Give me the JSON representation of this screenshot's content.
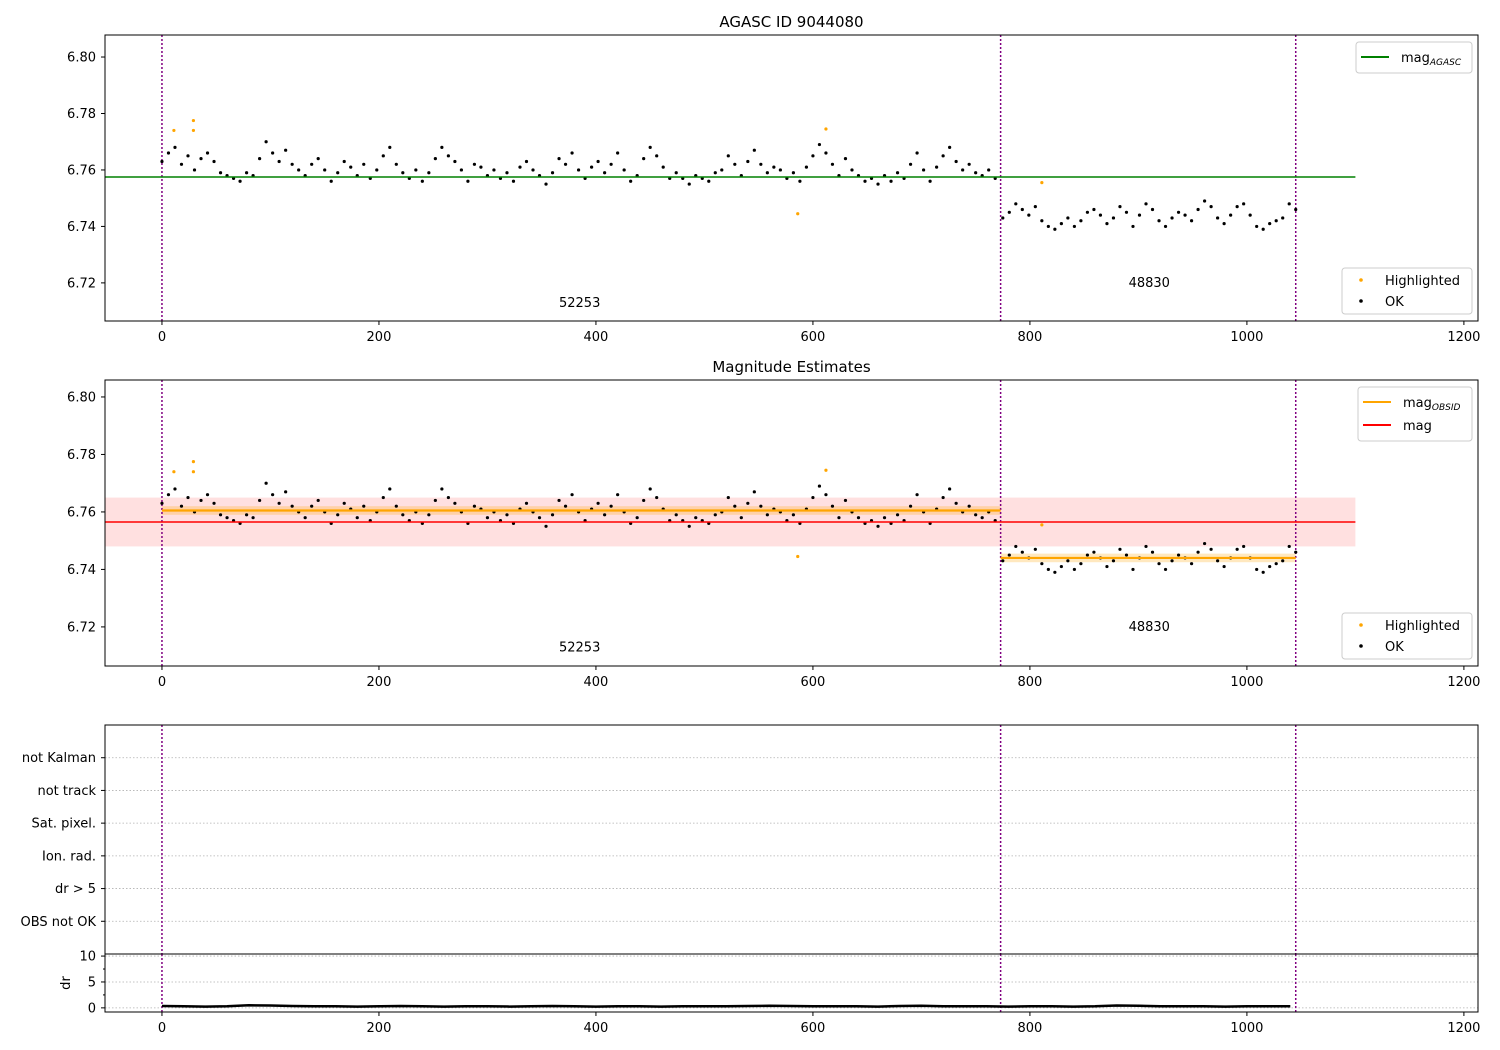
{
  "chart_data": [
    {
      "type": "scatter",
      "title": "AGASC ID 9044080",
      "xlim": [
        -52.5,
        1213
      ],
      "ylim": [
        6.7065,
        6.8078
      ],
      "xticks": [
        "0",
        "200",
        "400",
        "600",
        "800",
        "1000",
        "1200"
      ],
      "xtick_values": [
        0,
        200,
        400,
        600,
        800,
        1000,
        1200
      ],
      "yticks": [
        "6.72",
        "6.74",
        "6.76",
        "6.78",
        "6.80"
      ],
      "ytick_values": [
        6.72,
        6.74,
        6.76,
        6.78,
        6.8
      ],
      "vlines": {
        "x": [
          0,
          773,
          1045
        ],
        "color": "#800080",
        "style": "dotted"
      },
      "segments": [
        {
          "label": "52253",
          "label_x": 385,
          "label_y": 6.7115
        },
        {
          "label": "48830",
          "label_x": 910,
          "label_y": 6.7185
        }
      ],
      "hlines": [
        {
          "name": "mag",
          "sub": "AGASC",
          "y": 6.7575,
          "x": [
            -52.5,
            1100
          ],
          "color": "#008000"
        }
      ],
      "legend_top": {
        "placement": "top-right",
        "entries": [
          {
            "name": "mag",
            "sub": "AGASC",
            "color": "#008000"
          }
        ]
      },
      "legend_bottom": {
        "placement": "bottom-right",
        "entries": [
          {
            "name": "Highlighted",
            "color": "#ffa500"
          },
          {
            "name": "OK",
            "color": "#000000"
          }
        ]
      }
    },
    {
      "type": "scatter",
      "title": "Magnitude Estimates",
      "xlim": [
        -52.5,
        1213
      ],
      "ylim": [
        6.7064,
        6.8059
      ],
      "xticks": [
        "0",
        "200",
        "400",
        "600",
        "800",
        "1000",
        "1200"
      ],
      "xtick_values": [
        0,
        200,
        400,
        600,
        800,
        1000,
        1200
      ],
      "yticks": [
        "6.72",
        "6.74",
        "6.76",
        "6.78",
        "6.80"
      ],
      "ytick_values": [
        6.72,
        6.74,
        6.76,
        6.78,
        6.8
      ],
      "vlines": {
        "x": [
          0,
          773,
          1045
        ],
        "color": "#800080",
        "style": "dotted"
      },
      "segments": [
        {
          "label": "52253",
          "label_x": 385,
          "label_y": 6.7115
        },
        {
          "label": "48830",
          "label_x": 910,
          "label_y": 6.7185
        }
      ],
      "bands": [
        {
          "x": [
            -52.5,
            1100
          ],
          "y": [
            6.748,
            6.765
          ],
          "color": "#ff0000",
          "opacity": 0.12
        },
        {
          "x": [
            0,
            773
          ],
          "y": [
            6.759,
            6.762
          ],
          "color": "#ffa500",
          "opacity": 0.25
        },
        {
          "x": [
            773,
            1045
          ],
          "y": [
            6.7425,
            6.7455
          ],
          "color": "#ffa500",
          "opacity": 0.25
        }
      ],
      "hlines": [
        {
          "name": "mag",
          "y": 6.7565,
          "x": [
            -52.5,
            1100
          ],
          "color": "#ff0000"
        },
        {
          "name": "mag",
          "sub": "OBSID",
          "y": 6.7605,
          "x": [
            0,
            773
          ],
          "color": "#ffa500"
        },
        {
          "name": "mag",
          "sub": "OBSID",
          "y": 6.744,
          "x": [
            773,
            1045
          ],
          "color": "#ffa500"
        }
      ],
      "legend_top": {
        "placement": "top-right",
        "entries": [
          {
            "name": "mag",
            "sub": "OBSID",
            "color": "#ffa500"
          },
          {
            "name": "mag",
            "sub": "",
            "color": "#ff0000"
          }
        ]
      },
      "legend_bottom": {
        "placement": "bottom-right",
        "entries": [
          {
            "name": "Highlighted",
            "color": "#ffa500"
          },
          {
            "name": "OK",
            "color": "#000000"
          }
        ]
      }
    },
    {
      "type": "scatter",
      "xlim": [
        -52.5,
        1213
      ],
      "ylim": [
        -1,
        6
      ],
      "categories": [
        "OBS not OK",
        "dr > 5",
        "Ion. rad.",
        "Sat. pixel.",
        "not track",
        "not Kalman"
      ],
      "grid": true,
      "points": [],
      "vlines": {
        "x": [
          0,
          773,
          1045
        ],
        "color": "#800080",
        "style": "dotted"
      }
    },
    {
      "type": "line",
      "ylabel": "dr",
      "xlim": [
        -52.5,
        1213
      ],
      "ylim": [
        -0.8,
        10.4
      ],
      "xticks": [
        "0",
        "200",
        "400",
        "600",
        "800",
        "1000",
        "1200"
      ],
      "xtick_values": [
        0,
        200,
        400,
        600,
        800,
        1000,
        1200
      ],
      "yticks": [
        "0",
        "5",
        "10"
      ],
      "ytick_values": [
        0,
        5,
        10
      ],
      "grid": true,
      "vlines": {
        "x": [
          0,
          773,
          1045
        ],
        "color": "#800080",
        "style": "dotted"
      },
      "x_start": 0,
      "x_step": 20,
      "values": [
        0.35,
        0.3,
        0.25,
        0.3,
        0.5,
        0.45,
        0.35,
        0.3,
        0.3,
        0.25,
        0.3,
        0.35,
        0.3,
        0.25,
        0.3,
        0.3,
        0.25,
        0.3,
        0.35,
        0.3,
        0.25,
        0.3,
        0.3,
        0.25,
        0.3,
        0.3,
        0.3,
        0.35,
        0.4,
        0.35,
        0.3,
        0.3,
        0.3,
        0.25,
        0.35,
        0.4,
        0.3,
        0.3,
        0.3,
        0.25,
        0.3,
        0.3,
        0.25,
        0.3,
        0.45,
        0.4,
        0.3,
        0.3,
        0.3,
        0.25,
        0.3,
        0.3,
        0.3
      ]
    }
  ],
  "mag_data": {
    "ok_segments": [
      {
        "x_start": 0,
        "x_step": 6,
        "values": [
          6.763,
          6.766,
          6.768,
          6.762,
          6.765,
          6.76,
          6.764,
          6.766,
          6.763,
          6.759,
          6.758,
          6.757,
          6.756,
          6.759,
          6.758,
          6.764,
          6.77,
          6.766,
          6.763,
          6.767,
          6.762,
          6.76,
          6.758,
          6.762,
          6.764,
          6.76,
          6.756,
          6.759,
          6.763,
          6.761,
          6.758,
          6.762,
          6.757,
          6.76,
          6.765,
          6.768,
          6.762,
          6.759,
          6.757,
          6.76,
          6.756,
          6.759,
          6.764,
          6.768,
          6.765,
          6.763,
          6.76,
          6.756,
          6.762,
          6.761,
          6.758,
          6.76,
          6.757,
          6.759,
          6.756,
          6.761,
          6.763,
          6.76,
          6.758,
          6.755,
          6.759,
          6.764,
          6.762,
          6.766,
          6.76,
          6.757,
          6.761,
          6.763,
          6.759,
          6.762,
          6.766,
          6.76,
          6.756,
          6.758,
          6.764,
          6.768,
          6.765,
          6.761,
          6.757,
          6.759,
          6.757,
          6.755,
          6.758,
          6.757,
          6.756,
          6.759,
          6.76,
          6.765,
          6.762,
          6.758,
          6.763,
          6.767,
          6.762,
          6.759,
          6.761,
          6.76,
          6.757,
          6.759,
          6.756,
          6.761,
          6.765,
          6.769,
          6.766,
          6.762,
          6.758,
          6.764,
          6.76,
          6.758,
          6.756,
          6.757,
          6.755,
          6.758,
          6.756,
          6.759,
          6.757,
          6.762,
          6.766,
          6.76,
          6.756,
          6.761,
          6.765,
          6.768,
          6.763,
          6.76,
          6.762,
          6.759,
          6.758,
          6.76,
          6.757
        ]
      },
      {
        "x_start": 775,
        "x_step": 6,
        "values": [
          6.743,
          6.745,
          6.748,
          6.746,
          6.744,
          6.747,
          6.742,
          6.74,
          6.739,
          6.741,
          6.743,
          6.74,
          6.742,
          6.745,
          6.746,
          6.744,
          6.741,
          6.743,
          6.747,
          6.745,
          6.74,
          6.744,
          6.748,
          6.746,
          6.742,
          6.74,
          6.743,
          6.745,
          6.744,
          6.742,
          6.746,
          6.749,
          6.747,
          6.743,
          6.741,
          6.744,
          6.747,
          6.748,
          6.744,
          6.74,
          6.739,
          6.741,
          6.742,
          6.743,
          6.748,
          6.746
        ]
      }
    ],
    "highlighted": [
      [
        11,
        6.774
      ],
      [
        29,
        6.774
      ],
      [
        29,
        6.7775
      ],
      [
        586,
        6.7445
      ],
      [
        612,
        6.7745
      ],
      [
        811,
        6.7555
      ]
    ]
  }
}
